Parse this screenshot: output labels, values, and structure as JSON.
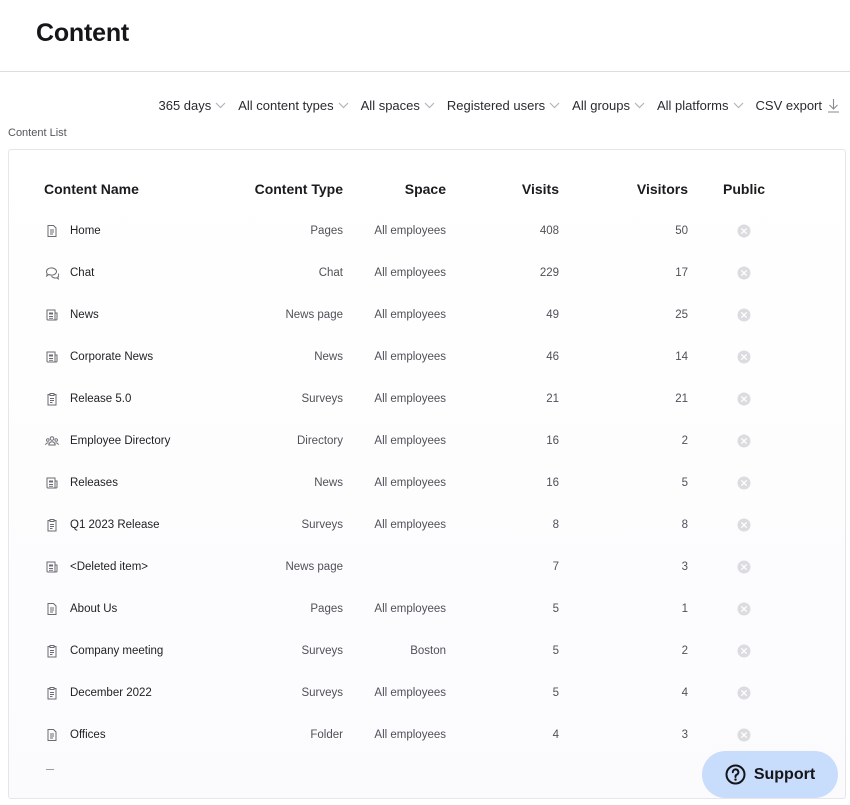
{
  "header": {
    "title": "Content"
  },
  "filters": [
    {
      "label": "365 days"
    },
    {
      "label": "All content types"
    },
    {
      "label": "All spaces"
    },
    {
      "label": "Registered users"
    },
    {
      "label": "All groups"
    },
    {
      "label": "All platforms"
    }
  ],
  "export": {
    "label": "CSV export"
  },
  "list": {
    "label": "Content List"
  },
  "table": {
    "columns": {
      "name": "Content Name",
      "type": "Content Type",
      "space": "Space",
      "visits": "Visits",
      "visitors": "Visitors",
      "public": "Public"
    },
    "rows": [
      {
        "icon": "page-icon",
        "name": "Home",
        "type": "Pages",
        "space": "All employees",
        "visits": "408",
        "visitors": "50",
        "public": false
      },
      {
        "icon": "chat-icon",
        "name": "Chat",
        "type": "Chat",
        "space": "All employees",
        "visits": "229",
        "visitors": "17",
        "public": false
      },
      {
        "icon": "newspaper-icon",
        "name": "News",
        "type": "News page",
        "space": "All employees",
        "visits": "49",
        "visitors": "25",
        "public": false
      },
      {
        "icon": "newspaper-icon",
        "name": "Corporate News",
        "type": "News",
        "space": "All employees",
        "visits": "46",
        "visitors": "14",
        "public": false
      },
      {
        "icon": "clipboard-icon",
        "name": "Release 5.0",
        "type": "Surveys",
        "space": "All employees",
        "visits": "21",
        "visitors": "21",
        "public": false
      },
      {
        "icon": "people-icon",
        "name": "Employee Directory",
        "type": "Directory",
        "space": "All employees",
        "visits": "16",
        "visitors": "2",
        "public": false
      },
      {
        "icon": "newspaper-icon",
        "name": "Releases",
        "type": "News",
        "space": "All employees",
        "visits": "16",
        "visitors": "5",
        "public": false
      },
      {
        "icon": "clipboard-icon",
        "name": "Q1 2023 Release",
        "type": "Surveys",
        "space": "All employees",
        "visits": "8",
        "visitors": "8",
        "public": false
      },
      {
        "icon": "newspaper-icon",
        "name": "<Deleted item>",
        "type": "News page",
        "space": "",
        "visits": "7",
        "visitors": "3",
        "public": false
      },
      {
        "icon": "page-icon",
        "name": "About Us",
        "type": "Pages",
        "space": "All employees",
        "visits": "5",
        "visitors": "1",
        "public": false
      },
      {
        "icon": "clipboard-icon",
        "name": "Company meeting",
        "type": "Surveys",
        "space": "Boston",
        "visits": "5",
        "visitors": "2",
        "public": false
      },
      {
        "icon": "clipboard-icon",
        "name": "December 2022",
        "type": "Surveys",
        "space": "All employees",
        "visits": "5",
        "visitors": "4",
        "public": false
      },
      {
        "icon": "page-icon",
        "name": "Offices",
        "type": "Folder",
        "space": "All employees",
        "visits": "4",
        "visitors": "3",
        "public": false
      }
    ]
  },
  "support": {
    "label": "Support"
  },
  "colors": {
    "accent": "#c8dcfb",
    "border": "#dcdce2",
    "icon": "#6a6a72",
    "public_off": "#dcdce0"
  }
}
